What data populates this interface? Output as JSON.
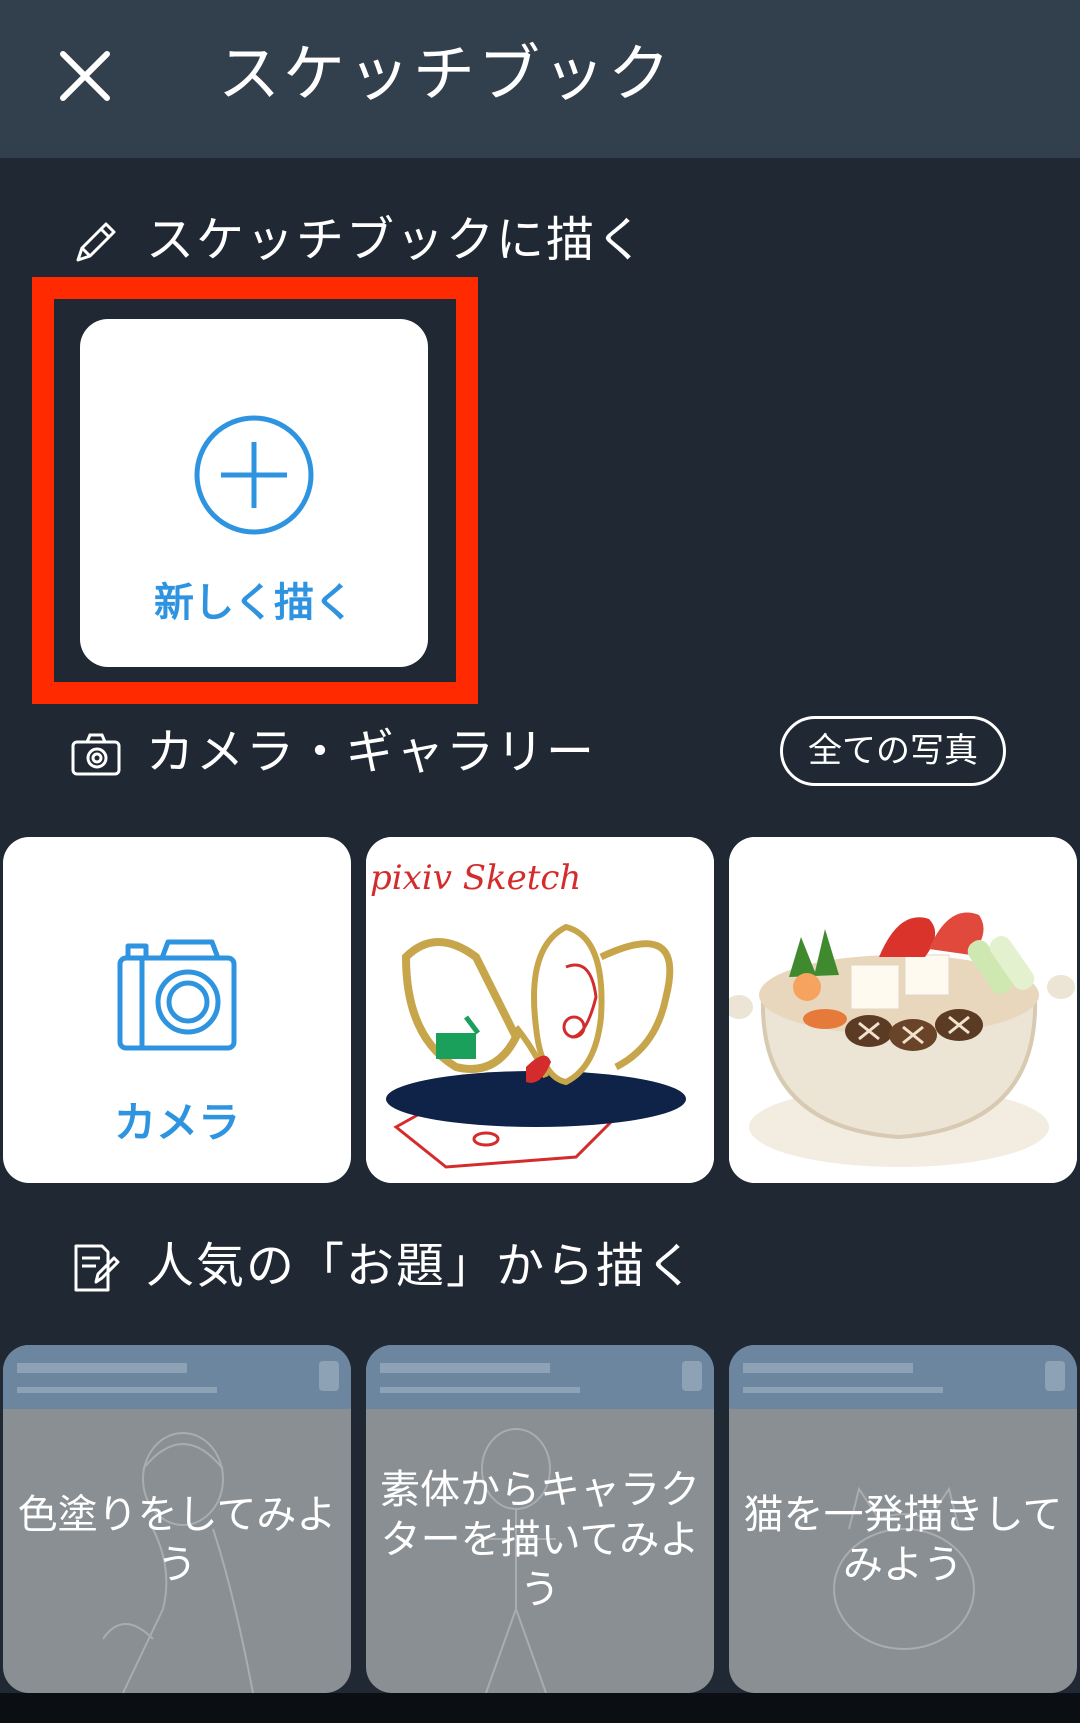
{
  "header": {
    "title": "スケッチブック",
    "close_icon": "close-icon"
  },
  "draw_section": {
    "label": "スケッチブックに描く",
    "icon": "pencil-icon",
    "new_card_label": "新しく描く",
    "accent_color": "#2e94e0",
    "highlight_color": "#ff2a00"
  },
  "gallery_section": {
    "label": "カメラ・ギャラリー",
    "icon": "camera-outline-icon",
    "all_photos_label": "全ての写真",
    "camera_label": "カメラ",
    "photo1_text": "pixiv Sketch"
  },
  "theme_section": {
    "label": "人気の「お題」から描く",
    "icon": "note-pencil-icon",
    "cards": [
      {
        "label": "色塗りをしてみよう"
      },
      {
        "label": "素体からキャラクターを描いてみよう"
      },
      {
        "label": "猫を一発描きしてみよう"
      }
    ]
  }
}
